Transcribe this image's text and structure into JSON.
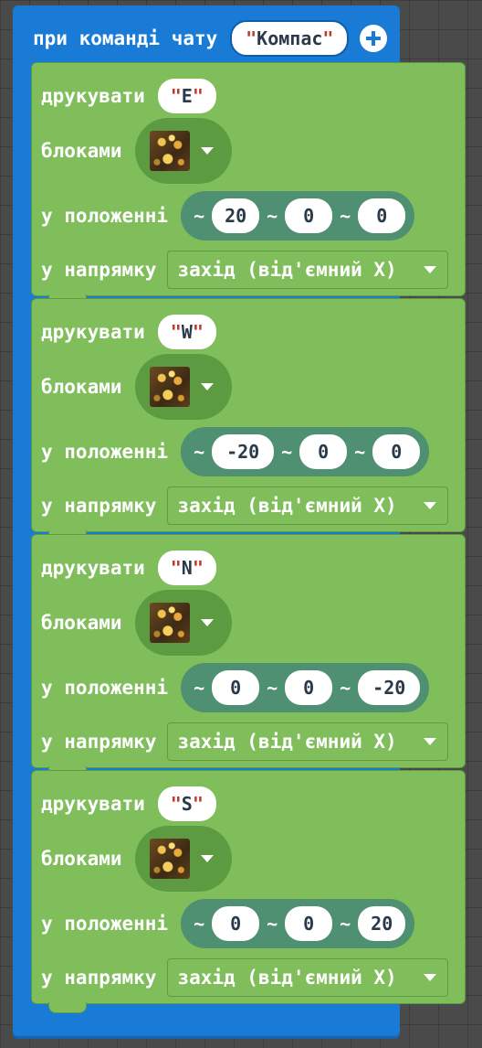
{
  "event": {
    "label": "при команді чату",
    "command_value": "Компас",
    "add_icon": "plus-circle-icon"
  },
  "labels": {
    "print": "друкувати",
    "blocks": "блоками",
    "position": "у положенні",
    "direction": "у напрямку",
    "tilde": "~"
  },
  "blocks": [
    {
      "text": "E",
      "block_icon": "gold-ore-block-icon",
      "x": "20",
      "y": "0",
      "z": "0",
      "direction": "захід (від'ємний X)"
    },
    {
      "text": "W",
      "block_icon": "gold-ore-block-icon",
      "x": "-20",
      "y": "0",
      "z": "0",
      "direction": "захід (від'ємний X)"
    },
    {
      "text": "N",
      "block_icon": "gold-ore-block-icon",
      "x": "0",
      "y": "0",
      "z": "-20",
      "direction": "захід (від'ємний X)"
    },
    {
      "text": "S",
      "block_icon": "gold-ore-block-icon",
      "x": "0",
      "y": "0",
      "z": "20",
      "direction": "захід (від'ємний X)"
    }
  ],
  "colors": {
    "event_block": "#1a7bd6",
    "action_block": "#7fbe5a",
    "position_block": "#4f8f72",
    "string_quote": "#c0392b"
  }
}
